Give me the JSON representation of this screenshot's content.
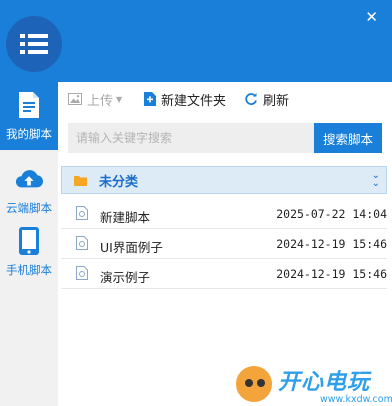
{
  "window": {
    "close_icon": "close-icon"
  },
  "sidebar": {
    "items": [
      {
        "label": "我的脚本",
        "icon": "document-icon",
        "active": true
      },
      {
        "label": "云端脚本",
        "icon": "cloud-upload-icon",
        "active": false
      },
      {
        "label": "手机脚本",
        "icon": "phone-icon",
        "active": false
      }
    ]
  },
  "toolbar": {
    "upload_label": "上传",
    "new_folder_label": "新建文件夹",
    "refresh_label": "刷新"
  },
  "search": {
    "placeholder": "请输入关键字搜索",
    "value": "",
    "button_label": "搜索脚本"
  },
  "group": {
    "name": "未分类"
  },
  "files": [
    {
      "name": "新建脚本",
      "date": "2025-07-22 14:04"
    },
    {
      "name": "UI界面例子",
      "date": "2024-12-19 15:46"
    },
    {
      "name": "演示例子",
      "date": "2024-12-19 15:46"
    }
  ],
  "watermark": {
    "text": "开心电玩",
    "url": "www.kxdw.com"
  },
  "colors": {
    "accent": "#1a7fd9",
    "logo_bg": "#1d63b8",
    "group_bg": "#ddebf7"
  }
}
